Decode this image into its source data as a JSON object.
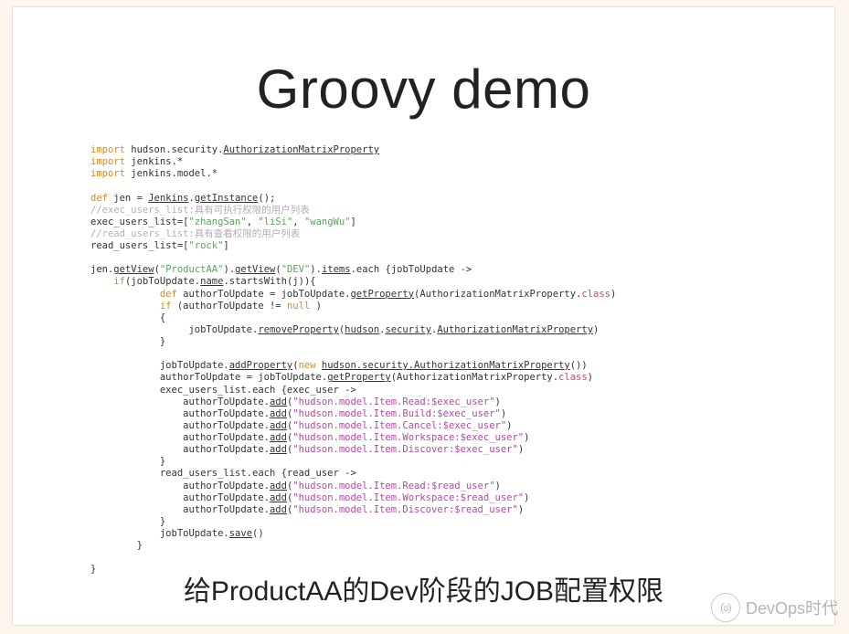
{
  "title": "Groovy demo",
  "subtitle": "给ProductAA的Dev阶段的JOB配置权限",
  "watermark": {
    "icon": "(ಠ)",
    "label": "DevOps时代"
  },
  "code": {
    "l01a": "import",
    "l01b": " hudson.security.",
    "l01c": "AuthorizationMatrixProperty",
    "l02a": "import",
    "l02b": " jenkins.*",
    "l03a": "import",
    "l03b": " jenkins.model.*",
    "l04": "",
    "l05a": "def",
    "l05b": " jen = ",
    "l05c": "Jenkins",
    "l05d": ".",
    "l05e": "getInstance",
    "l05f": "();",
    "l06": "//exec_users_list:具有可执行权限的用户列表",
    "l07a": "exec_users_list=[",
    "l07b": "\"zhangSan\"",
    "l07c": ", ",
    "l07d": "\"liSi\"",
    "l07e": ", ",
    "l07f": "\"wangWu\"",
    "l07g": "]",
    "l08": "//read_users_list:具有查看权限的用户列表",
    "l09a": "read_users_list=[",
    "l09b": "\"rock\"",
    "l09c": "]",
    "l10": "",
    "l11a": "jen.",
    "l11b": "getView",
    "l11c": "(",
    "l11d": "\"ProductAA\"",
    "l11e": ").",
    "l11f": "getView",
    "l11g": "(",
    "l11h": "\"DEV\"",
    "l11i": ").",
    "l11j": "items",
    "l11k": ".each {jobToUpdate ->",
    "l12a": "    ",
    "l12b": "if",
    "l12c": "(jobToUpdate.",
    "l12d": "name",
    "l12e": ".startsWith(j)){",
    "l13a": "            ",
    "l13b": "def",
    "l13c": " authorToUpdate = jobToUpdate.",
    "l13d": "getProperty",
    "l13e": "(AuthorizationMatrixProperty.",
    "l13f": "class",
    "l13g": ")",
    "l14a": "            ",
    "l14b": "if",
    "l14c": " (authorToUpdate != ",
    "l14d": "null",
    "l14e": " )",
    "l15": "            {",
    "l16a": "                 jobToUpdate.",
    "l16b": "removeProperty",
    "l16c": "(",
    "l16d": "hudson",
    "l16e": ".",
    "l16f": "security",
    "l16g": ".",
    "l16h": "AuthorizationMatrixProperty",
    "l16i": ")",
    "l17": "            }",
    "l18": "",
    "l19a": "            jobToUpdate.",
    "l19b": "addProperty",
    "l19c": "(",
    "l19d": "new",
    "l19e": " ",
    "l19f": "hudson.security.AuthorizationMatrixProperty",
    "l19g": "())",
    "l20a": "            authorToUpdate = jobToUpdate.",
    "l20b": "getProperty",
    "l20c": "(AuthorizationMatrixProperty.",
    "l20d": "class",
    "l20e": ")",
    "l21": "            exec_users_list.each {exec_user ->",
    "l22a": "                authorToUpdate.",
    "l22b": "add",
    "l22c": "(",
    "l22d": "\"hudson.model.Item.Read:$exec_user\"",
    "l22e": ")",
    "l23a": "                authorToUpdate.",
    "l23b": "add",
    "l23c": "(",
    "l23d": "\"hudson.model.Item.Build:$exec_user\"",
    "l23e": ")",
    "l24a": "                authorToUpdate.",
    "l24b": "add",
    "l24c": "(",
    "l24d": "\"hudson.model.Item.Cancel:$exec_user\"",
    "l24e": ")",
    "l25a": "                authorToUpdate.",
    "l25b": "add",
    "l25c": "(",
    "l25d": "\"hudson.model.Item.Workspace:$exec_user\"",
    "l25e": ")",
    "l26a": "                authorToUpdate.",
    "l26b": "add",
    "l26c": "(",
    "l26d": "\"hudson.model.Item.Discover:$exec_user\"",
    "l26e": ")",
    "l27": "            }",
    "l28": "            read_users_list.each {read_user ->",
    "l29a": "                authorToUpdate.",
    "l29b": "add",
    "l29c": "(",
    "l29d": "\"hudson.model.Item.Read:$read_user\"",
    "l29e": ")",
    "l30a": "                authorToUpdate.",
    "l30b": "add",
    "l30c": "(",
    "l30d": "\"hudson.model.Item.Workspace:$read_user\"",
    "l30e": ")",
    "l31a": "                authorToUpdate.",
    "l31b": "add",
    "l31c": "(",
    "l31d": "\"hudson.model.Item.Discover:$read_user\"",
    "l31e": ")",
    "l32": "            }",
    "l33a": "            jobToUpdate.",
    "l33b": "save",
    "l33c": "()",
    "l34": "        }",
    "l35": "",
    "l36": "}"
  }
}
